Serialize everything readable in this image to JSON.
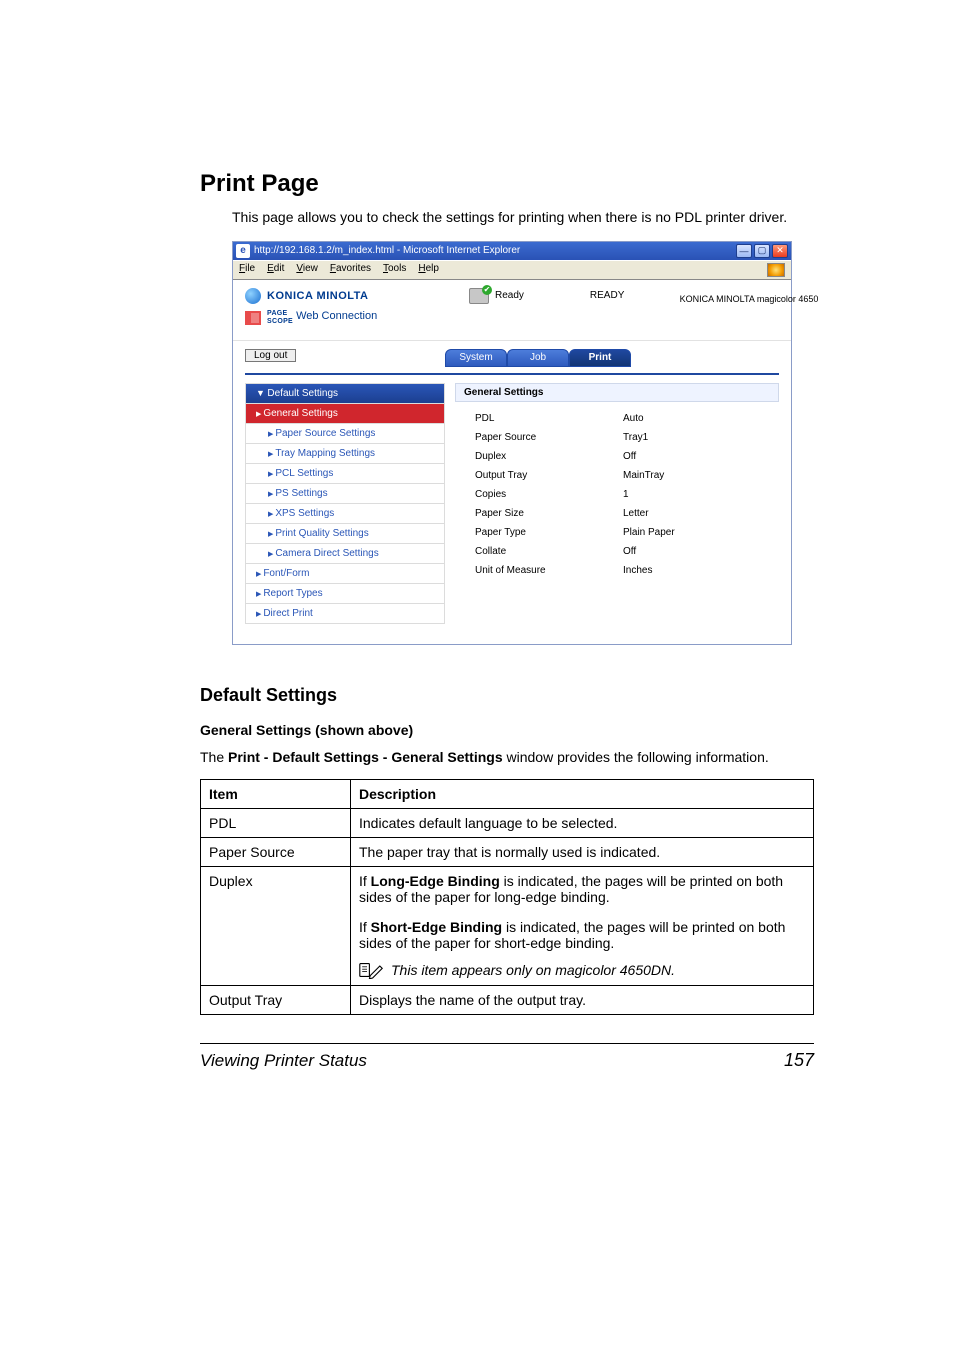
{
  "section_title": "Print Page",
  "intro": "This page allows you to check the settings for printing when there is no PDL printer driver.",
  "browser": {
    "title": "http://192.168.1.2/m_index.html - Microsoft Internet Explorer",
    "menu": {
      "file": "File",
      "edit": "Edit",
      "view": "View",
      "favorites": "Favorites",
      "tools": "Tools",
      "help": "Help"
    },
    "brand": "KONICA MINOLTA",
    "pagescope_small": "PAGE\nSCOPE",
    "pagescope_label": "Web Connection",
    "status_label": "Ready",
    "status_big": "READY",
    "model": "KONICA MINOLTA magicolor 4650",
    "logout": "Log out",
    "tabs": {
      "system": "System",
      "job": "Job",
      "print": "Print"
    }
  },
  "sidebar": {
    "header": "Default Settings",
    "items": [
      {
        "label": "General Settings",
        "kind": "sel"
      },
      {
        "label": "Paper Source Settings",
        "kind": "sub"
      },
      {
        "label": "Tray Mapping Settings",
        "kind": "sub"
      },
      {
        "label": "PCL Settings",
        "kind": "sub"
      },
      {
        "label": "PS Settings",
        "kind": "sub"
      },
      {
        "label": "XPS Settings",
        "kind": "sub"
      },
      {
        "label": "Print Quality Settings",
        "kind": "sub"
      },
      {
        "label": "Camera Direct Settings",
        "kind": "sub"
      },
      {
        "label": "Font/Form",
        "kind": "root"
      },
      {
        "label": "Report Types",
        "kind": "root"
      },
      {
        "label": "Direct Print",
        "kind": "root"
      }
    ]
  },
  "panel": {
    "heading": "General Settings",
    "rows": [
      {
        "k": "PDL",
        "v": "Auto"
      },
      {
        "k": "Paper Source",
        "v": "Tray1"
      },
      {
        "k": "Duplex",
        "v": "Off"
      },
      {
        "k": "Output Tray",
        "v": "MainTray"
      },
      {
        "k": "Copies",
        "v": "1"
      },
      {
        "k": "Paper Size",
        "v": "Letter"
      },
      {
        "k": "Paper Type",
        "v": "Plain Paper"
      },
      {
        "k": "Collate",
        "v": "Off"
      },
      {
        "k": "Unit of Measure",
        "v": "Inches"
      }
    ]
  },
  "subhead": "Default Settings",
  "subsub": "General Settings (shown above)",
  "body_pre": "The ",
  "body_strong": "Print - Default Settings - General Settings",
  "body_post": " window provides the following information.",
  "table": {
    "h1": "Item",
    "h2": "Description",
    "rows": {
      "pdl": {
        "item": "PDL",
        "desc": "Indicates default language to be selected."
      },
      "paper_source": {
        "item": "Paper Source",
        "desc": "The paper tray that is normally used is indicated."
      },
      "duplex": {
        "item": "Duplex",
        "p1a": "If ",
        "p1b": "Long-Edge Binding",
        "p1c": " is indicated, the pages will be printed on both sides of the paper for long-edge binding.",
        "p2a": "If ",
        "p2b": "Short-Edge Binding",
        "p2c": " is indicated, the pages will be printed on both sides of the paper for short-edge binding.",
        "note": "This item appears only on magicolor 4650DN."
      },
      "output_tray": {
        "item": "Output Tray",
        "desc": "Displays the name of the output tray."
      }
    }
  },
  "footer": {
    "left": "Viewing Printer Status",
    "right": "157"
  }
}
